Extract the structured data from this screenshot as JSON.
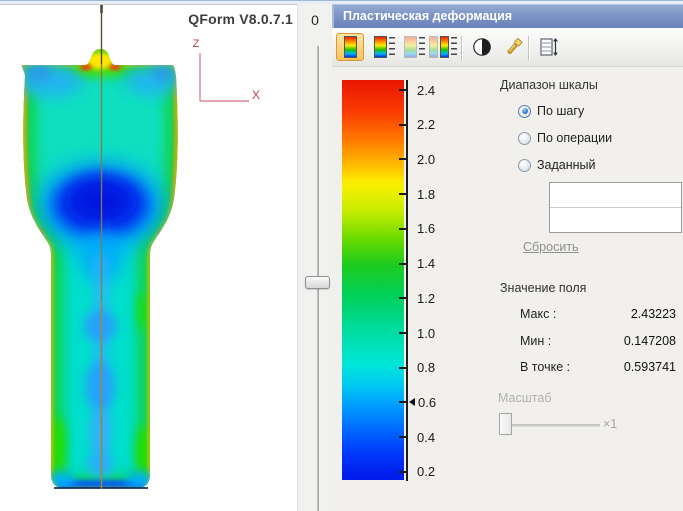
{
  "left_view": {
    "watermark": "QForm V8.0.7.1",
    "axis": {
      "z": "Z",
      "x": "X",
      "color": "#c84b5c"
    },
    "step_indicator": "0"
  },
  "panel": {
    "title": "Пластическая деформация",
    "toolbar": {
      "icons": [
        {
          "name": "colorbar-solid-icon",
          "selected": true
        },
        {
          "name": "colorbar-ticks-icon",
          "selected": false
        },
        {
          "name": "colorbar-pale-icon",
          "selected": false
        },
        {
          "name": "colorbar-double-icon",
          "selected": false
        },
        {
          "name": "contrast-icon",
          "selected": false
        },
        {
          "name": "flashlight-icon",
          "selected": false
        },
        {
          "name": "scale-height-icon",
          "selected": false
        }
      ]
    },
    "colorbar": {
      "ticks": [
        "2.4",
        "2.2",
        "2.0",
        "1.8",
        "1.6",
        "1.4",
        "1.2",
        "1.0",
        "0.8",
        "0.6",
        "0.4",
        "0.2"
      ],
      "pointer_tick": "0.6",
      "top_color": "#e81600",
      "bottom_color": "#0018e8"
    },
    "scale_range": {
      "label": "Диапазон шкалы",
      "options": [
        {
          "label": "По шагу",
          "selected": true
        },
        {
          "label": "По операции",
          "selected": false
        },
        {
          "label": "Заданный",
          "selected": false
        }
      ],
      "max_input": "",
      "min_input": "",
      "reset_label": "Сбросить"
    },
    "field_value": {
      "label": "Значение поля",
      "rows": [
        {
          "label": "Макс :",
          "value": "2.43223"
        },
        {
          "label": "Мин :",
          "value": "0.147208"
        },
        {
          "label": "В точке :",
          "value": "0.593741"
        }
      ]
    },
    "scale": {
      "label": "Масштаб",
      "multiplier": "×1"
    }
  }
}
